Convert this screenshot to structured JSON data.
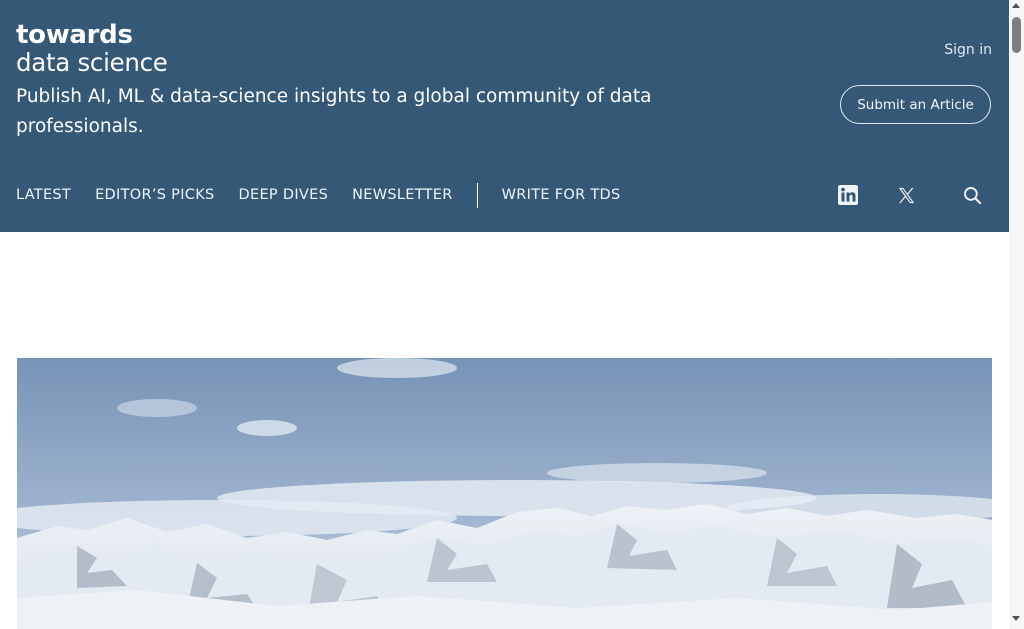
{
  "header": {
    "logo": {
      "line1": "towards",
      "line2": "data science"
    },
    "tagline": "Publish AI, ML & data-science insights to a global community of data professionals.",
    "sign_in": "Sign in",
    "submit_button": "Submit an Article",
    "background_color": "#355876"
  },
  "nav": {
    "items": [
      "LATEST",
      "EDITOR’S PICKS",
      "DEEP DIVES",
      "NEWSLETTER"
    ],
    "write": "WRITE FOR TDS"
  },
  "social": {
    "icons": [
      "linkedin-icon",
      "x-twitter-icon",
      "search-icon"
    ]
  },
  "hero": {
    "subject": "snow-covered mountain range under a blue sky"
  }
}
